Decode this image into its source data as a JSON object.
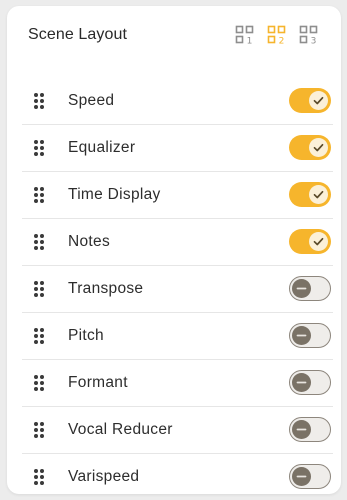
{
  "header": {
    "title": "Scene Layout",
    "layouts": [
      {
        "icon": "layout-grid-1-icon",
        "selected": false
      },
      {
        "icon": "layout-grid-2-icon",
        "selected": true
      },
      {
        "icon": "layout-grid-3-icon",
        "selected": false
      }
    ]
  },
  "items": [
    {
      "label": "Speed",
      "enabled": true
    },
    {
      "label": "Equalizer",
      "enabled": true
    },
    {
      "label": "Time Display",
      "enabled": true
    },
    {
      "label": "Notes",
      "enabled": true
    },
    {
      "label": "Transpose",
      "enabled": false
    },
    {
      "label": "Pitch",
      "enabled": false
    },
    {
      "label": "Formant",
      "enabled": false
    },
    {
      "label": "Vocal Reducer",
      "enabled": false
    },
    {
      "label": "Varispeed",
      "enabled": false
    }
  ],
  "colors": {
    "accent": "#f6b52c",
    "icon_inactive": "#8e8e8e",
    "toggle_off_knob": "#7a7266"
  }
}
